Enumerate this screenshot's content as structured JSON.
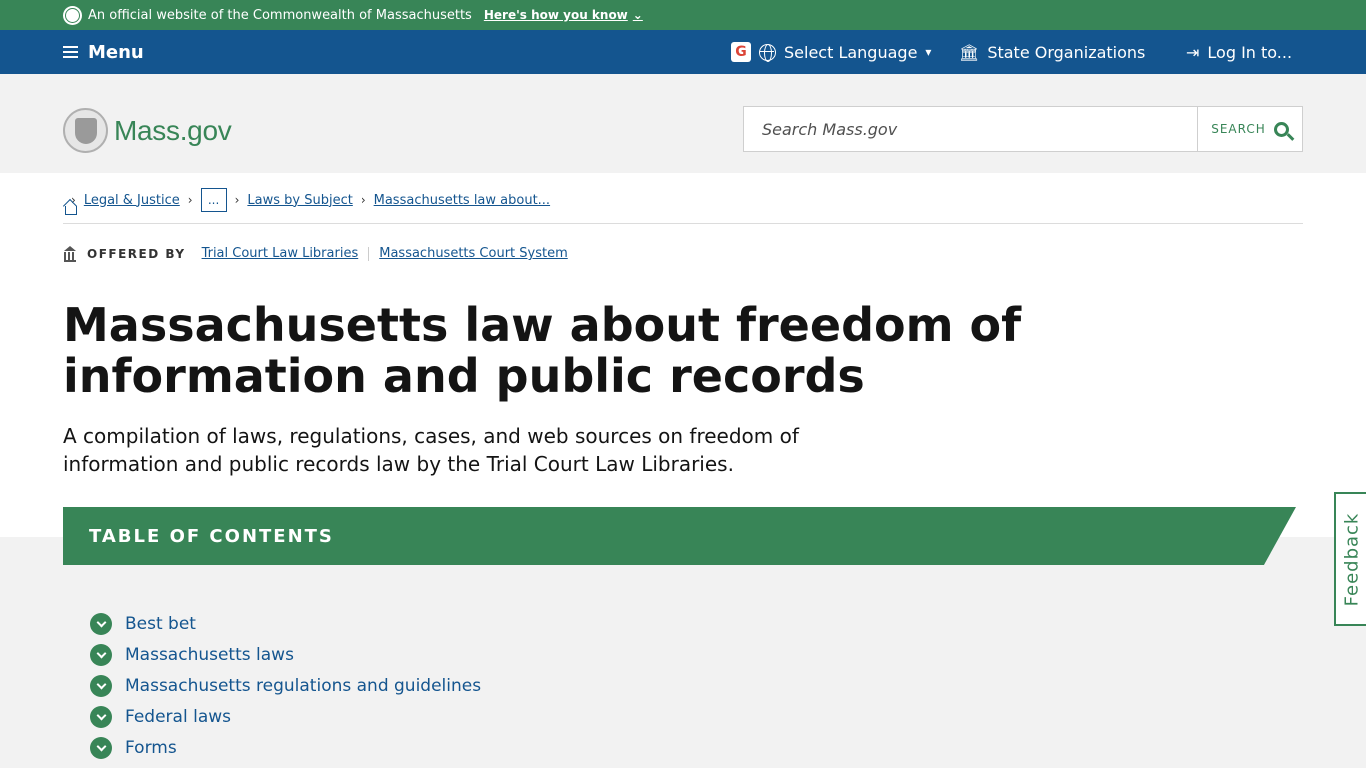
{
  "official_banner": {
    "text": "An official website of the Commonwealth of Massachusetts",
    "link": "Here's how you know"
  },
  "utility_bar": {
    "menu": "Menu",
    "language": "Select Language",
    "state_orgs": "State Organizations",
    "login": "Log In to..."
  },
  "header": {
    "logo_text": "Mass.gov",
    "search_placeholder": "Search Mass.gov",
    "search_button": "SEARCH"
  },
  "breadcrumb": {
    "items": [
      "Legal & Justice",
      "...",
      "Laws by Subject",
      "Massachusetts law about..."
    ]
  },
  "offered_by": {
    "label": "OFFERED BY",
    "orgs": [
      "Trial Court Law Libraries",
      "Massachusetts Court System"
    ]
  },
  "page": {
    "title": "Massachusetts law about freedom of information and public records",
    "lede": "A compilation of laws, regulations, cases, and web sources on freedom of information and public records law by the Trial Court Law Libraries."
  },
  "toc": {
    "heading": "TABLE OF CONTENTS",
    "items": [
      "Best bet",
      "Massachusetts laws",
      "Massachusetts regulations and guidelines",
      "Federal laws",
      "Forms"
    ]
  },
  "feedback": "Feedback",
  "colors": {
    "green": "#388557",
    "blue": "#14558f",
    "gray_bg": "#f2f2f2"
  }
}
